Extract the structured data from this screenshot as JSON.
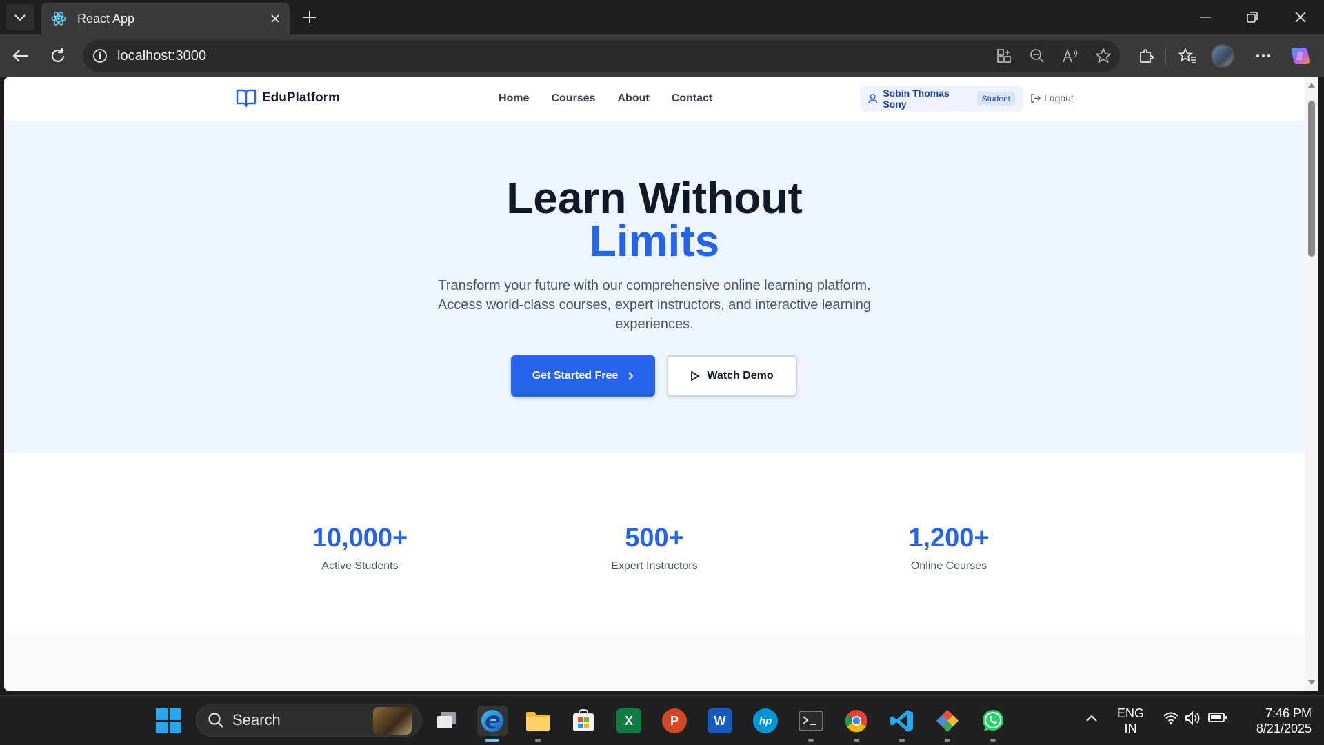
{
  "browser": {
    "tab_title": "React App",
    "url": "localhost:3000"
  },
  "site": {
    "brand": "EduPlatform",
    "nav": [
      "Home",
      "Courses",
      "About",
      "Contact"
    ],
    "user": {
      "name": "Sobin Thomas Sony",
      "role": "Student"
    },
    "logout_label": "Logout",
    "accent_color": "#2563eb"
  },
  "hero": {
    "title_line1": "Learn Without",
    "title_line2": "Limits",
    "subtitle": "Transform your future with our comprehensive online learning platform. Access world-class courses, expert instructors, and interactive learning experiences.",
    "primary_cta": "Get Started Free",
    "secondary_cta": "Watch Demo"
  },
  "stats": [
    {
      "value": "10,000+",
      "label": "Active Students"
    },
    {
      "value": "500+",
      "label": "Expert Instructors"
    },
    {
      "value": "1,200+",
      "label": "Online Courses"
    }
  ],
  "taskbar": {
    "search_label": "Search",
    "language": {
      "line1": "ENG",
      "line2": "IN"
    },
    "time": "7:46 PM",
    "date": "8/21/2025",
    "apps": [
      "task-view",
      "edge",
      "file-explorer",
      "microsoft-store",
      "excel",
      "powerpoint",
      "word",
      "hp",
      "terminal",
      "chrome",
      "vscode",
      "git-kraken",
      "whatsapp"
    ]
  }
}
